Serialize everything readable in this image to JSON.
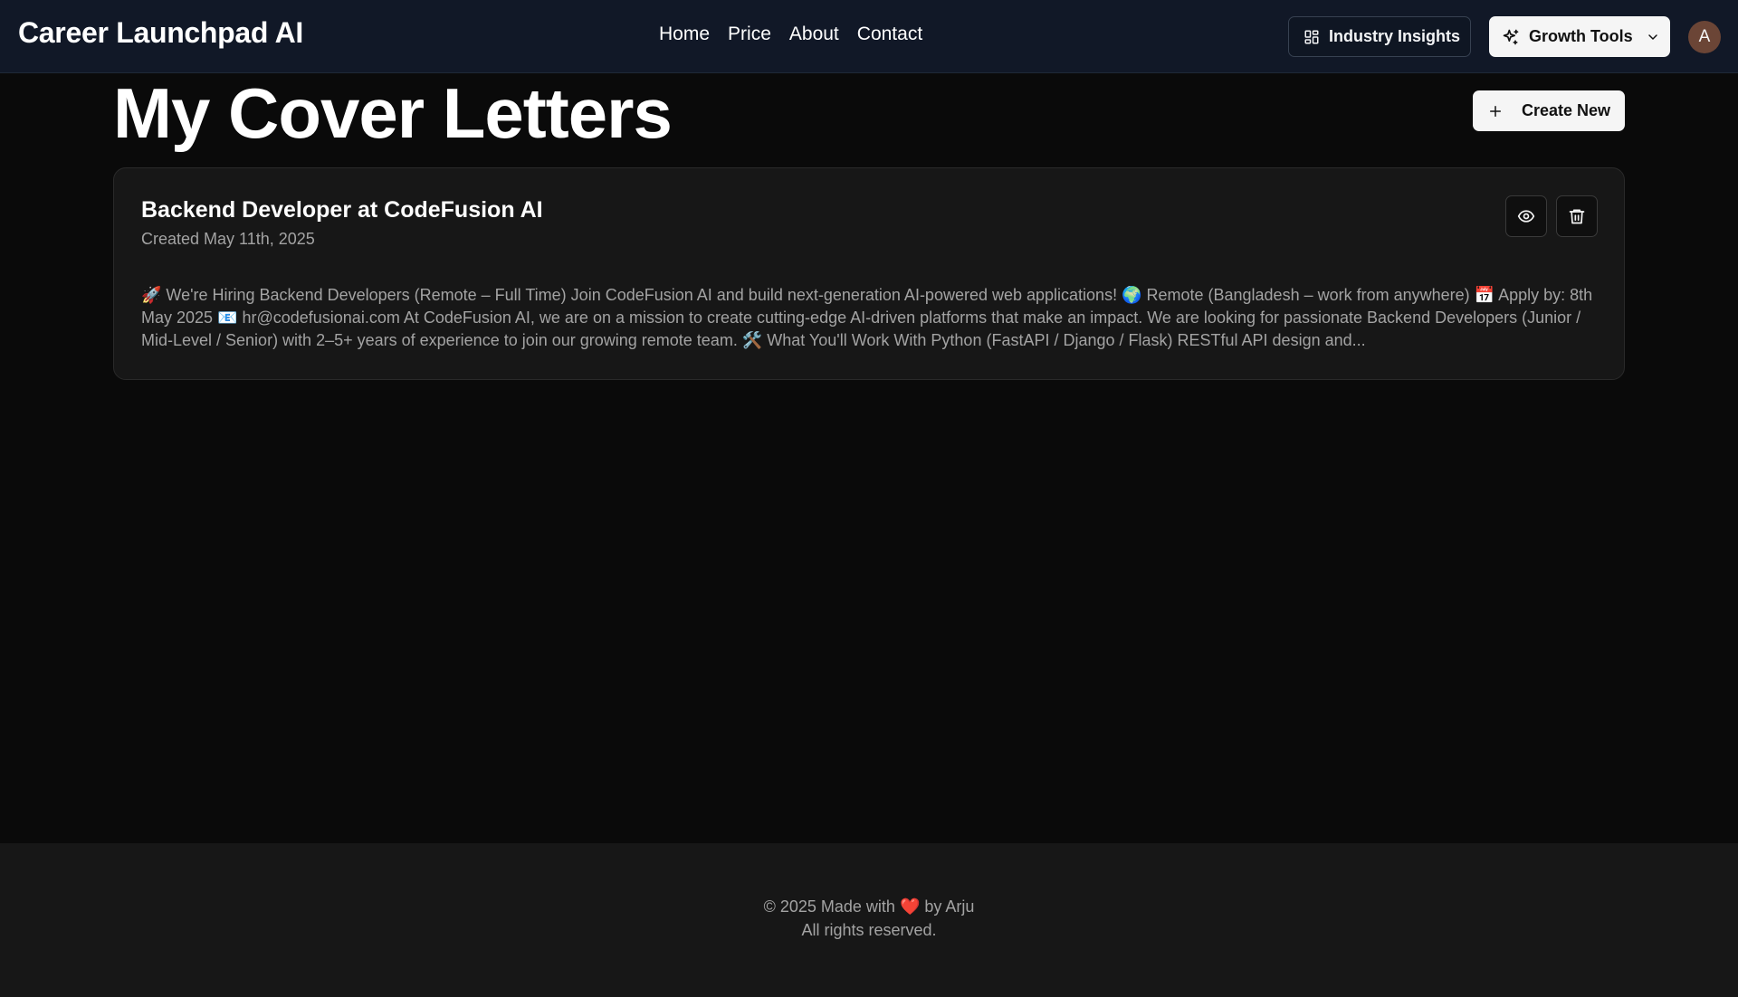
{
  "header": {
    "brand": "Career Launchpad AI",
    "nav": [
      "Home",
      "Price",
      "About",
      "Contact"
    ],
    "insights_label": "Industry Insights",
    "growth_label": "Growth Tools",
    "avatar_initial": "A"
  },
  "main": {
    "title": "My Cover Letters",
    "create_label": "Create New",
    "letters": [
      {
        "title": "Backend Developer at CodeFusion AI",
        "created": "Created May 11th, 2025",
        "preview": "🚀 We're Hiring Backend Developers (Remote – Full Time) Join CodeFusion AI and build next-generation AI-powered web applications! 🌍 Remote (Bangladesh – work from anywhere) 📅 Apply by: 8th May 2025 📧 hr@codefusionai.com At CodeFusion AI, we are on a mission to create cutting-edge AI-driven platforms that make an impact. We are looking for passionate Backend Developers (Junior / Mid-Level / Senior) with 2–5+ years of experience to join our growing remote team. 🛠️ What You'll Work With Python (FastAPI / Django / Flask) RESTful API design and..."
      }
    ]
  },
  "footer": {
    "line1_prefix": "© 2025 Made with",
    "heart": "❤️",
    "line1_suffix": "by Arju",
    "line2": "All rights reserved."
  },
  "colors": {
    "header_bg": "#111827",
    "page_bg": "#0a0a0a",
    "card_bg": "#171717",
    "button_light": "#f5f5f5",
    "muted_text": "#a3a3a3",
    "avatar_bg": "#6b4536"
  }
}
